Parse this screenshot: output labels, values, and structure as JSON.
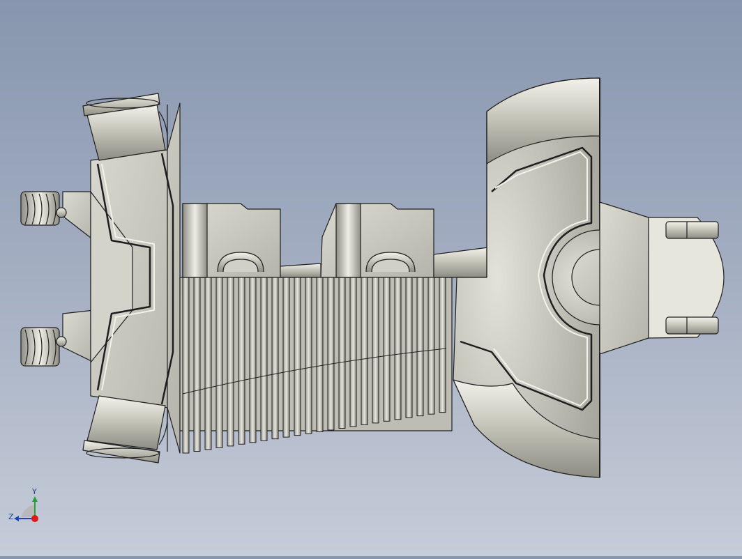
{
  "viewport": {
    "background_top": "#8796ae",
    "background_bottom": "#c6ccd8",
    "model": {
      "name": "engine-cylinder-head-assembly",
      "display_mode": "shaded-with-edges",
      "body_color": "#c9c9be",
      "edge_color": "#1e1e1e"
    }
  },
  "triad": {
    "y_label": "Y",
    "z_label": "Z",
    "y_color": "#1aa832",
    "z_color": "#1f3fc8",
    "x_color": "#e01818"
  }
}
